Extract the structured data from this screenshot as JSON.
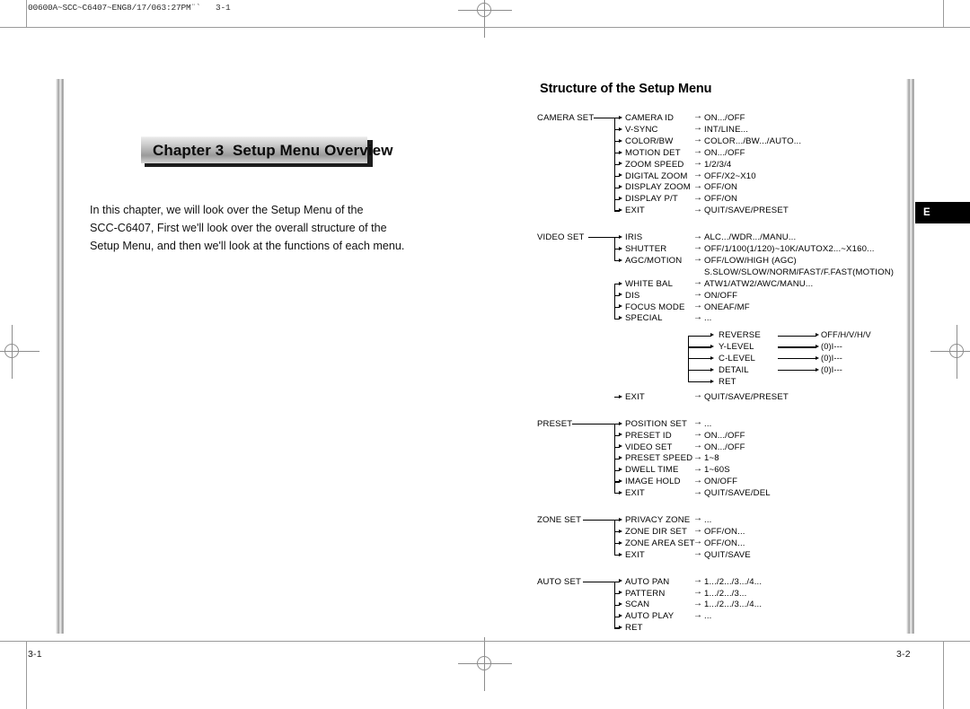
{
  "slug": "00600A~SCC~C6407~ENG8/17/063:27PM¨`   3-1",
  "left_page": {
    "chapter_banner": "Chapter 3  Setup Menu Overview",
    "intro_lines": [
      "In this chapter, we will look over the Setup Menu of the",
      "SCC-C6407, First we'll look over the overall structure of the",
      "Setup Menu, and then we'll look at the functions of each menu."
    ],
    "folio": "3-1"
  },
  "right_page": {
    "title": "Structure of the Setup Menu",
    "thumb_tab": "E",
    "folio": "3-2"
  },
  "menu_tree": {
    "groups": [
      {
        "name": "CAMERA SET",
        "items": [
          {
            "label": "CAMERA ID",
            "value": "ON.../OFF"
          },
          {
            "label": "V-SYNC",
            "value": "INT/LINE..."
          },
          {
            "label": "COLOR/BW",
            "value": "COLOR.../BW.../AUTO..."
          },
          {
            "label": "MOTION DET",
            "value": "ON.../OFF"
          },
          {
            "label": "ZOOM SPEED",
            "value": "1/2/3/4"
          },
          {
            "label": "DIGITAL ZOOM",
            "value": "OFF/X2~X10"
          },
          {
            "label": "DISPLAY ZOOM",
            "value": "OFF/ON"
          },
          {
            "label": "DISPLAY P/T",
            "value": "OFF/ON"
          },
          {
            "label": "EXIT",
            "value": "QUIT/SAVE/PRESET"
          }
        ]
      },
      {
        "name": "VIDEO SET",
        "items": [
          {
            "label": "IRIS",
            "value": "ALC.../WDR.../MANU..."
          },
          {
            "label": "SHUTTER",
            "value": "OFF/1/100(1/120)~10K/AUTOX2...~X160..."
          },
          {
            "label": "AGC/MOTION",
            "value": "OFF/LOW/HIGH (AGC)",
            "value2": "S.SLOW/SLOW/NORM/FAST/F.FAST(MOTION)"
          },
          {
            "label": "WHITE BAL",
            "value": "ATW1/ATW2/AWC/MANU..."
          },
          {
            "label": "DIS",
            "value": "ON/OFF"
          },
          {
            "label": "FOCUS MODE",
            "value": "ONEAF/MF"
          },
          {
            "label": "SPECIAL",
            "value": "..."
          },
          {
            "label": "EXIT",
            "value": "QUIT/SAVE/PRESET"
          }
        ],
        "sub_branch": {
          "parent": "SPECIAL",
          "items": [
            {
              "label": "REVERSE",
              "value": "OFF/H/V/H/V"
            },
            {
              "label": "Y-LEVEL",
              "value": "(0)I---"
            },
            {
              "label": "C-LEVEL",
              "value": "(0)I---"
            },
            {
              "label": "DETAIL",
              "value": "(0)I---"
            },
            {
              "label": "RET",
              "value": ""
            }
          ]
        }
      },
      {
        "name": "PRESET",
        "items": [
          {
            "label": "POSITION SET",
            "value": "..."
          },
          {
            "label": "PRESET ID",
            "value": "ON.../OFF"
          },
          {
            "label": "VIDEO SET",
            "value": "ON.../OFF"
          },
          {
            "label": "PRESET SPEED",
            "value": "1~8"
          },
          {
            "label": "DWELL TIME",
            "value": "1~60S"
          },
          {
            "label": "IMAGE HOLD",
            "value": "ON/OFF"
          },
          {
            "label": "EXIT",
            "value": "QUIT/SAVE/DEL"
          }
        ]
      },
      {
        "name": "ZONE SET",
        "items": [
          {
            "label": "PRIVACY ZONE",
            "value": "..."
          },
          {
            "label": "ZONE DIR SET",
            "value": "OFF/ON..."
          },
          {
            "label": "ZONE AREA SET",
            "value": "OFF/ON..."
          },
          {
            "label": "EXIT",
            "value": "QUIT/SAVE"
          }
        ]
      },
      {
        "name": "AUTO SET",
        "items": [
          {
            "label": "AUTO PAN",
            "value": "1.../2.../3.../4..."
          },
          {
            "label": "PATTERN",
            "value": "1.../2.../3..."
          },
          {
            "label": "SCAN",
            "value": "1.../2.../3.../4..."
          },
          {
            "label": "AUTO PLAY",
            "value": "..."
          },
          {
            "label": "RET",
            "value": ""
          }
        ]
      }
    ]
  }
}
